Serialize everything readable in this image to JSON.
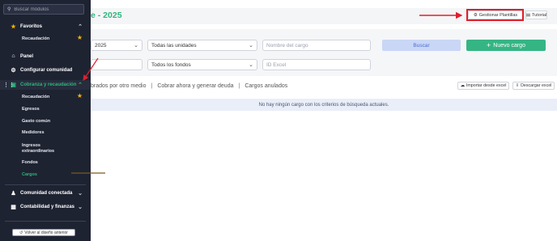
{
  "sidebar": {
    "search_placeholder": "Buscar módulos",
    "favoritos": {
      "label": "Favoritos",
      "items": [
        {
          "label": "Recaudación"
        }
      ]
    },
    "panel": {
      "label": "Panel"
    },
    "configurar": {
      "label": "Configurar comunidad"
    },
    "cobranza": {
      "label": "Cobranza y recaudación",
      "items": [
        {
          "label": "Recaudación"
        },
        {
          "label": "Egresos"
        },
        {
          "label": "Gasto común"
        },
        {
          "label": "Medidores"
        },
        {
          "label": "Ingresos"
        },
        {
          "label": "extraordinarios"
        },
        {
          "label": "Fondos"
        },
        {
          "label": "Cargos"
        }
      ]
    },
    "comunidad": {
      "label": "Comunidad conectada"
    },
    "contabilidad": {
      "label": "Contabilidad y finanzas"
    },
    "old_design_label": "Volver al diseño anterior"
  },
  "header": {
    "title": "e - 2025",
    "plantillas_label": "Gestionar Plantillas",
    "tutorial_label": "Tutorial"
  },
  "filters": {
    "year_value": "2025",
    "units_value": "Todas las unidades",
    "cargo_name_placeholder": "Nombre del cargo",
    "fondos_value": "Todos los fondos",
    "id_excel_placeholder": "ID Excel",
    "buscar_label": "Buscar",
    "nuevo_label": "Nuevo cargo"
  },
  "tabs": {
    "tab1": "brados por otro medio",
    "tab2": "Cobrar ahora y generar deuda",
    "tab3": "Cargos anulados",
    "separator": "|"
  },
  "actions": {
    "import_label": "Importar desde excel",
    "export_label": "Descargar excel"
  },
  "empty_message": "No hay ningún cargo con los criterios de búsqueda actuales.",
  "colors": {
    "accent_green": "#2fb67c",
    "annotation_red": "#e01e2b",
    "sidebar_bg": "#1e2332",
    "star": "#f5b301"
  }
}
